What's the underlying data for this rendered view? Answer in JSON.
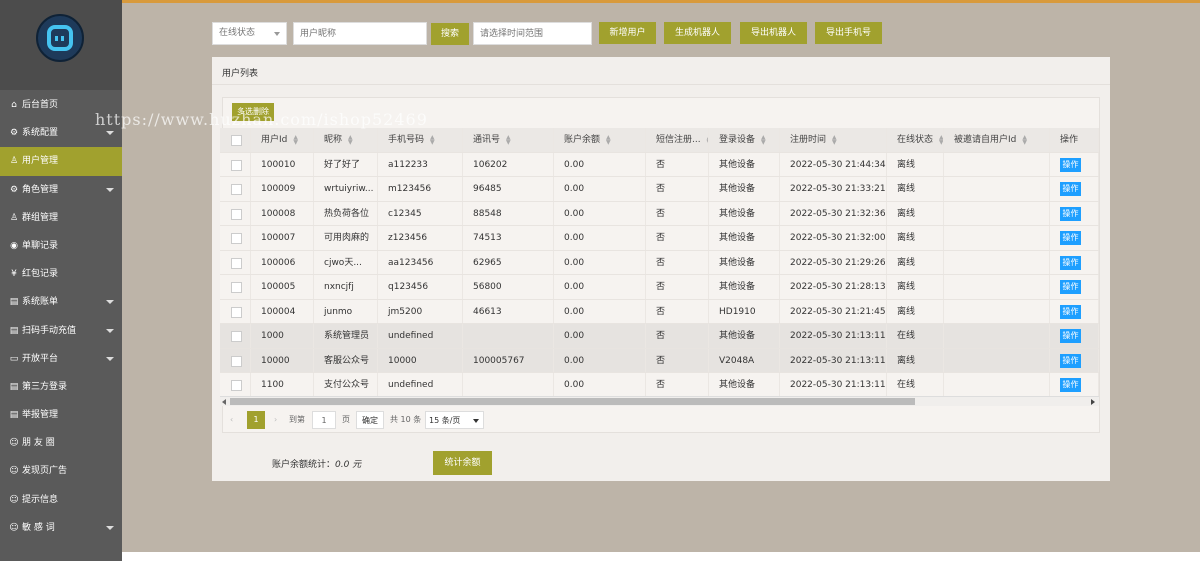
{
  "sidebar": {
    "items": [
      {
        "label": "后台首页",
        "icon": "home-icon",
        "glyph": "⌂",
        "caret": false,
        "active": false
      },
      {
        "label": "系统配置",
        "icon": "gear-icon",
        "glyph": "⚙",
        "caret": true,
        "active": false
      },
      {
        "label": "用户管理",
        "icon": "user-icon",
        "glyph": "♙",
        "caret": false,
        "active": true
      },
      {
        "label": "角色管理",
        "icon": "role-icon",
        "glyph": "⚙",
        "caret": true,
        "active": false
      },
      {
        "label": "群组管理",
        "icon": "group-icon",
        "glyph": "♙",
        "caret": false,
        "active": false
      },
      {
        "label": "单聊记录",
        "icon": "eye-icon",
        "glyph": "◉",
        "caret": false,
        "active": false
      },
      {
        "label": "红包记录",
        "icon": "yen-icon",
        "glyph": "¥",
        "caret": false,
        "active": false
      },
      {
        "label": "系统账单",
        "icon": "bill-icon",
        "glyph": "▤",
        "caret": true,
        "active": false
      },
      {
        "label": "扫码手动充值",
        "icon": "scan-icon",
        "glyph": "▤",
        "caret": true,
        "active": false
      },
      {
        "label": "开放平台",
        "icon": "platform-icon",
        "glyph": "▭",
        "caret": true,
        "active": false
      },
      {
        "label": "第三方登录",
        "icon": "login-icon",
        "glyph": "▤",
        "caret": false,
        "active": false
      },
      {
        "label": "举报管理",
        "icon": "report-icon",
        "glyph": "▤",
        "caret": false,
        "active": false
      },
      {
        "label": "朋 友 圈",
        "icon": "smile-icon",
        "glyph": "☺",
        "caret": false,
        "active": false
      },
      {
        "label": "发现页广告",
        "icon": "ad-icon",
        "glyph": "☺",
        "caret": false,
        "active": false
      },
      {
        "label": "提示信息",
        "icon": "info-icon",
        "glyph": "☺",
        "caret": false,
        "active": false
      },
      {
        "label": "敏 感 词",
        "icon": "keyword-icon",
        "glyph": "☺",
        "caret": true,
        "active": false
      }
    ]
  },
  "toolbar": {
    "status_select": "在线状态",
    "nickname_placeholder": "用户昵称",
    "search_label": "搜索",
    "time_placeholder": "请选择时间范围",
    "add_user_label": "新增用户",
    "gen_robot_label": "生成机器人",
    "export_robot_label": "导出机器人",
    "export_phone_label": "导出手机号"
  },
  "panel": {
    "title": "用户列表",
    "bulk_delete_label": "多选删除"
  },
  "table": {
    "headers": [
      "用户Id",
      "昵称",
      "手机号码",
      "通讯号",
      "账户余额",
      "短信注册...",
      "登录设备",
      "注册时间",
      "在线状态",
      "被邀请自用户Id",
      "操作"
    ],
    "rows": [
      {
        "id": "100010",
        "nick": "好了好了",
        "phone": "a112233",
        "comm": "106202",
        "balance": "0.00",
        "sms": "否",
        "device": "其他设备",
        "time": "2022-05-30 21:44:34",
        "online": "离线",
        "inviter": "",
        "op": "操作"
      },
      {
        "id": "100009",
        "nick": "wrtuiyriw...",
        "phone": "m123456",
        "comm": "96485",
        "balance": "0.00",
        "sms": "否",
        "device": "其他设备",
        "time": "2022-05-30 21:33:21",
        "online": "离线",
        "inviter": "",
        "op": "操作"
      },
      {
        "id": "100008",
        "nick": "热负荷各位",
        "phone": "c12345",
        "comm": "88548",
        "balance": "0.00",
        "sms": "否",
        "device": "其他设备",
        "time": "2022-05-30 21:32:36",
        "online": "离线",
        "inviter": "",
        "op": "操作"
      },
      {
        "id": "100007",
        "nick": "可用肉麻的",
        "phone": "z123456",
        "comm": "74513",
        "balance": "0.00",
        "sms": "否",
        "device": "其他设备",
        "time": "2022-05-30 21:32:00",
        "online": "离线",
        "inviter": "",
        "op": "操作"
      },
      {
        "id": "100006",
        "nick": "cjwo天...",
        "phone": "aa123456",
        "comm": "62965",
        "balance": "0.00",
        "sms": "否",
        "device": "其他设备",
        "time": "2022-05-30 21:29:26",
        "online": "离线",
        "inviter": "",
        "op": "操作"
      },
      {
        "id": "100005",
        "nick": "nxncjfj",
        "phone": "q123456",
        "comm": "56800",
        "balance": "0.00",
        "sms": "否",
        "device": "其他设备",
        "time": "2022-05-30 21:28:13",
        "online": "离线",
        "inviter": "",
        "op": "操作"
      },
      {
        "id": "100004",
        "nick": "junmo",
        "phone": "jm5200",
        "comm": "46613",
        "balance": "0.00",
        "sms": "否",
        "device": "HD1910",
        "time": "2022-05-30 21:21:45",
        "online": "离线",
        "inviter": "",
        "op": "操作"
      },
      {
        "id": "1000",
        "nick": "系统管理员",
        "phone": "undefined",
        "comm": "",
        "balance": "0.00",
        "sms": "否",
        "device": "其他设备",
        "time": "2022-05-30 21:13:11",
        "online": "在线",
        "inviter": "",
        "op": "操作"
      },
      {
        "id": "10000",
        "nick": "客服公众号",
        "phone": "10000",
        "comm": "100005767",
        "balance": "0.00",
        "sms": "否",
        "device": "V2048A",
        "time": "2022-05-30 21:13:11",
        "online": "离线",
        "inviter": "",
        "op": "操作"
      },
      {
        "id": "1100",
        "nick": "支付公众号",
        "phone": "undefined",
        "comm": "",
        "balance": "0.00",
        "sms": "否",
        "device": "其他设备",
        "time": "2022-05-30 21:13:11",
        "online": "在线",
        "inviter": "",
        "op": "操作"
      }
    ]
  },
  "pagination": {
    "prev": "‹",
    "current": "1",
    "next": "›",
    "goto_label": "到第",
    "goto_value": "1",
    "page_unit": "页",
    "confirm_label": "确定",
    "total_text": "共 10 条",
    "page_size": "15 条/页"
  },
  "stats": {
    "label": "账户余额统计：",
    "value": "0.0 元",
    "button_label": "统计余额"
  },
  "watermark": "https://www.huzhan.com/ishop52469",
  "colors": {
    "accent": "#a1a12e",
    "sidebar": "#5a5a5a",
    "main_bg": "#bdb4a8",
    "op_button": "#1e9fff"
  }
}
